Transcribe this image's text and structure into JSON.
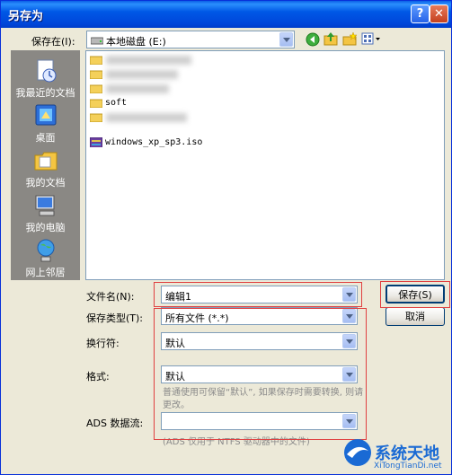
{
  "window": {
    "title": "另存为",
    "help_btn": "?",
    "close_btn": "✕"
  },
  "save_in": {
    "label": "保存在(I):",
    "value": "本地磁盘 (E:)"
  },
  "toolbar": {
    "icons": [
      "back-icon",
      "up-folder-icon",
      "new-folder-icon",
      "view-menu-icon"
    ]
  },
  "places": [
    {
      "label": "我最近的文档",
      "icon": "recent-documents-icon"
    },
    {
      "label": "桌面",
      "icon": "desktop-icon"
    },
    {
      "label": "我的文档",
      "icon": "my-documents-icon"
    },
    {
      "label": "我的电脑",
      "icon": "my-computer-icon"
    },
    {
      "label": "网上邻居",
      "icon": "network-places-icon"
    }
  ],
  "files": [
    {
      "name": "",
      "type": "folder"
    },
    {
      "name": "",
      "type": "folder"
    },
    {
      "name": "",
      "type": "folder"
    },
    {
      "name": "soft",
      "type": "folder"
    },
    {
      "name": "",
      "type": "folder"
    },
    {
      "name": "windows_xp_sp3.iso",
      "type": "iso"
    }
  ],
  "filename": {
    "label": "文件名(N):",
    "value": "编辑1"
  },
  "filetype": {
    "label": "保存类型(T):",
    "value": "所有文件 (*.*)"
  },
  "newline": {
    "label": "换行符:",
    "value": "默认"
  },
  "format": {
    "label": "格式:",
    "value": "默认"
  },
  "format_note": "普通使用可保留“默认”, 如果保存时需要转换, 则请更改。",
  "ads": {
    "label": "ADS 数据流:",
    "value": ""
  },
  "ads_note": "(ADS 仅用于 NTFS 驱动器中的文件)",
  "buttons": {
    "save": "保存(S)",
    "cancel": "取消"
  },
  "watermark": {
    "title": "系统天地",
    "url": "XiTongTianDi.net"
  }
}
